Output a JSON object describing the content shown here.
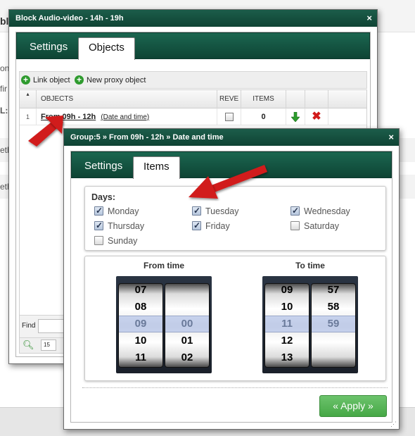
{
  "background": {
    "title_fragment": "bl",
    "row_fragments": [
      "ont",
      "fir",
      "L:",
      "eth",
      "eth"
    ]
  },
  "dialog1": {
    "title": "Block Audio-video - 14h - 19h",
    "close": "×",
    "tabs": [
      "Settings",
      "Objects"
    ],
    "active_tab": "Objects",
    "toolbar": {
      "link_object": "Link object",
      "new_proxy_object": "New proxy object"
    },
    "grid": {
      "columns": [
        "OBJECTS",
        "REVE",
        "ITEMS"
      ],
      "rows": [
        {
          "num": "1",
          "name": "From 09h - 12h",
          "detail": "(Date and time)",
          "items": "0"
        }
      ]
    },
    "find_label": "Find",
    "page_size": "15"
  },
  "dialog2": {
    "title": "Group:5 » From 09h - 12h » Date and time",
    "close": "×",
    "tabs": [
      "Settings",
      "Items"
    ],
    "active_tab": "Items",
    "days_label": "Days:",
    "days": [
      {
        "label": "Monday",
        "checked": true
      },
      {
        "label": "Tuesday",
        "checked": true
      },
      {
        "label": "Wednesday",
        "checked": true
      },
      {
        "label": "Thursday",
        "checked": true
      },
      {
        "label": "Friday",
        "checked": true
      },
      {
        "label": "Saturday",
        "checked": false
      },
      {
        "label": "Sunday",
        "checked": false
      }
    ],
    "from_time": {
      "label": "From time",
      "hours": [
        "07",
        "08",
        "09",
        "10",
        "11"
      ],
      "minutes": [
        "",
        "",
        "00",
        "01",
        "02"
      ]
    },
    "to_time": {
      "label": "To time",
      "hours": [
        "09",
        "10",
        "11",
        "12",
        "13"
      ],
      "minutes": [
        "57",
        "58",
        "59",
        "",
        ""
      ]
    },
    "apply": "« Apply »"
  },
  "colors": {
    "title_bar": "#0f4334",
    "apply": "#4caf50",
    "arrow": "#d11a1a",
    "delete": "#d11a1a",
    "down_arrow": "#2c9c2c"
  }
}
